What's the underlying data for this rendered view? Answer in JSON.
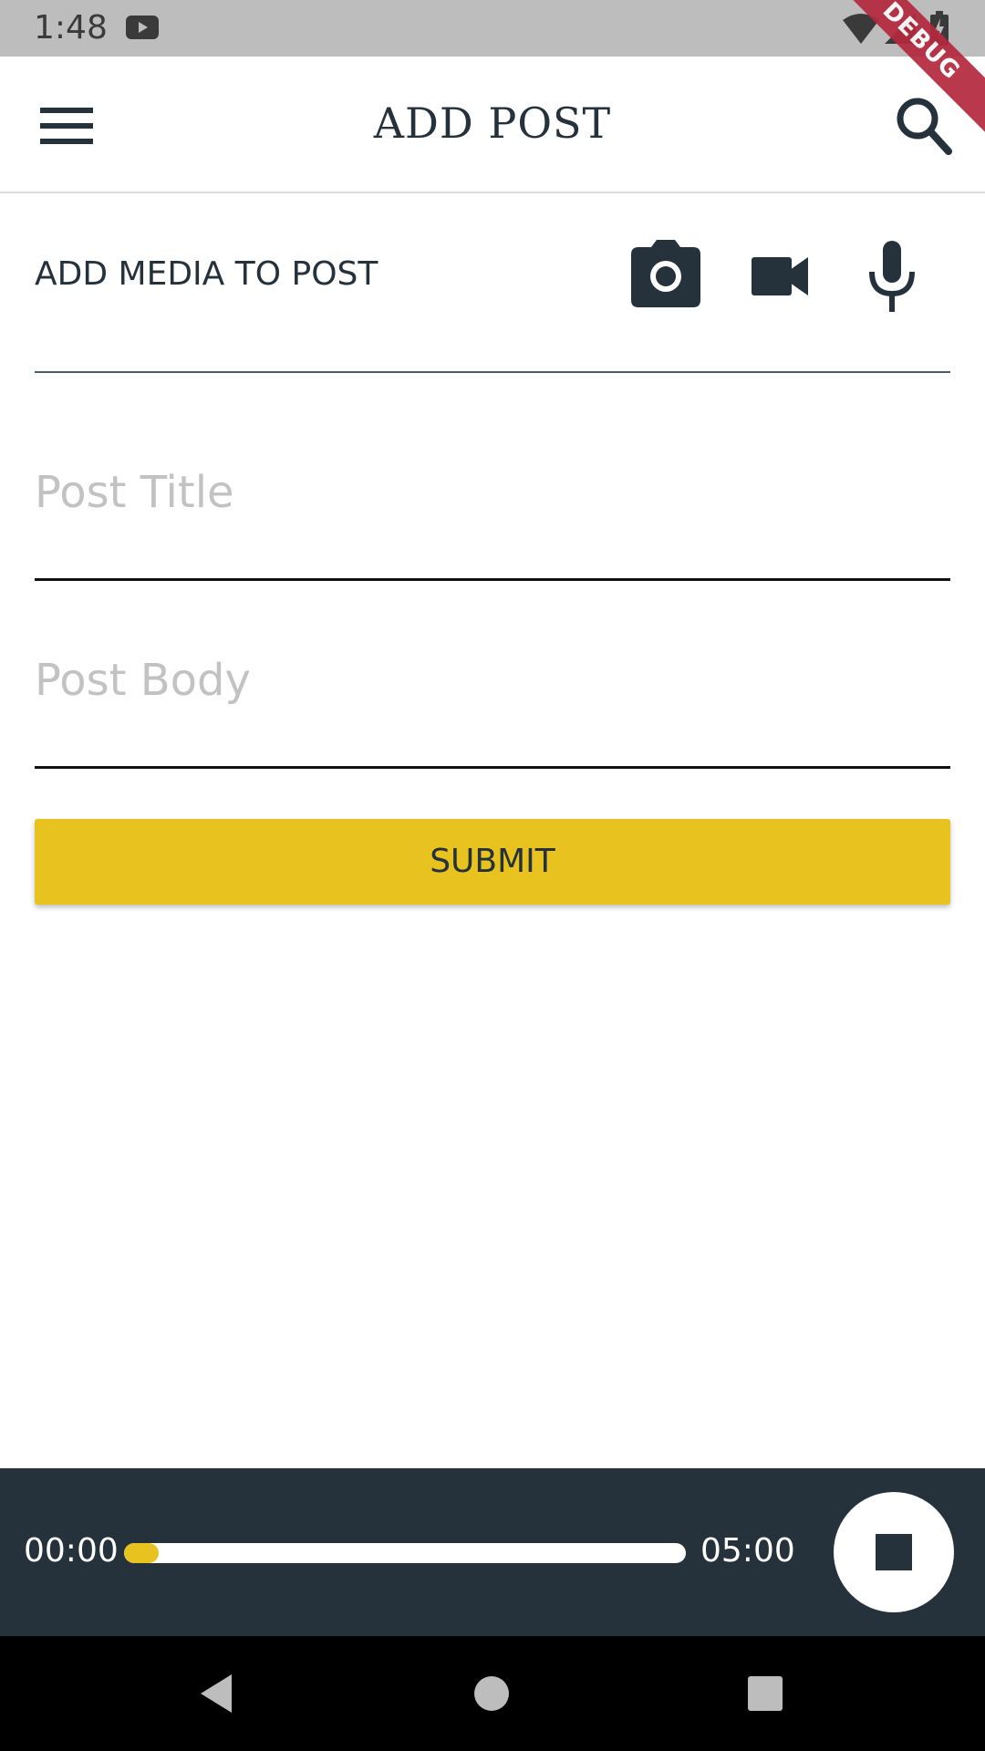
{
  "status_bar": {
    "time": "1:48",
    "icons": [
      "youtube-icon",
      "wifi-icon",
      "signal-icon",
      "battery-icon"
    ]
  },
  "debug_ribbon": {
    "label": "DEBUG",
    "color": "#b5283d"
  },
  "app_bar": {
    "title": "ADD POST",
    "menu_icon": "menu-icon",
    "search_icon": "search-icon"
  },
  "media": {
    "label": "ADD MEDIA TO POST",
    "icons": [
      "camera-icon",
      "video-camera-icon",
      "microphone-icon"
    ]
  },
  "form": {
    "title_placeholder": "Post Title",
    "title_value": "",
    "body_placeholder": "Post Body",
    "body_value": "",
    "submit_label": "SUBMIT"
  },
  "player": {
    "current_time": "00:00",
    "total_time": "05:00",
    "progress": 0.0,
    "stop_icon": "stop-icon"
  },
  "colors": {
    "primary_dark": "#25323b",
    "accent": "#e8c21f",
    "placeholder": "#c2c2c2"
  },
  "nav_bar": {
    "icons": [
      "back-icon",
      "home-icon",
      "recent-apps-icon"
    ]
  }
}
